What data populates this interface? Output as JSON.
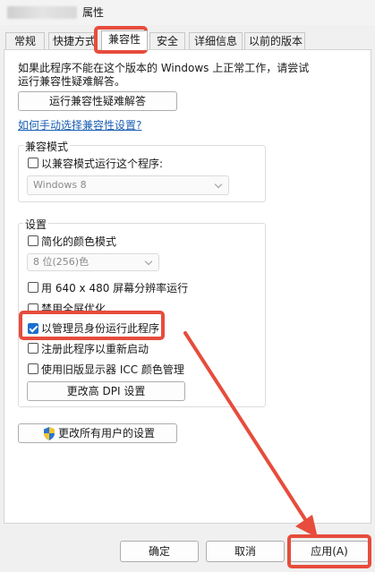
{
  "window": {
    "title": "属性"
  },
  "tabs": [
    {
      "label": "常规"
    },
    {
      "label": "快捷方式"
    },
    {
      "label": "兼容性"
    },
    {
      "label": "安全"
    },
    {
      "label": "详细信息"
    },
    {
      "label": "以前的版本"
    }
  ],
  "intro": {
    "line1": "如果此程序不能在这个版本的 Windows 上正常工作，请尝试",
    "line2": "运行兼容性疑难解答。"
  },
  "troubleshooter_button": "运行兼容性疑难解答",
  "manual_link": "如何手动选择兼容性设置?",
  "compat_mode": {
    "title": "兼容模式",
    "checkbox_label": "以兼容模式运行这个程序:",
    "os_select": "Windows 8"
  },
  "settings": {
    "title": "设置",
    "reduced_color": "简化的颜色模式",
    "color_select": "8 位(256)色",
    "res_640": "用 640 x 480 屏幕分辨率运行",
    "disable_fullscreen": "禁用全屏优化",
    "run_as_admin": "以管理员身份运行此程序",
    "register_restart": "注册此程序以重新启动",
    "legacy_icc": "使用旧版显示器 ICC 颜色管理",
    "dpi_button": "更改高 DPI 设置"
  },
  "all_users_button": "更改所有用户的设置",
  "footer": {
    "ok": "确定",
    "cancel": "取消",
    "apply": "应用(A)"
  },
  "colors": {
    "annotation": "#e74c3c",
    "accent": "#1a6fd0",
    "link": "#1a5fb4"
  },
  "icons": {
    "shield": "uac-shield-icon",
    "check": "checkmark-icon",
    "dropdown": "chevron-down-icon"
  }
}
